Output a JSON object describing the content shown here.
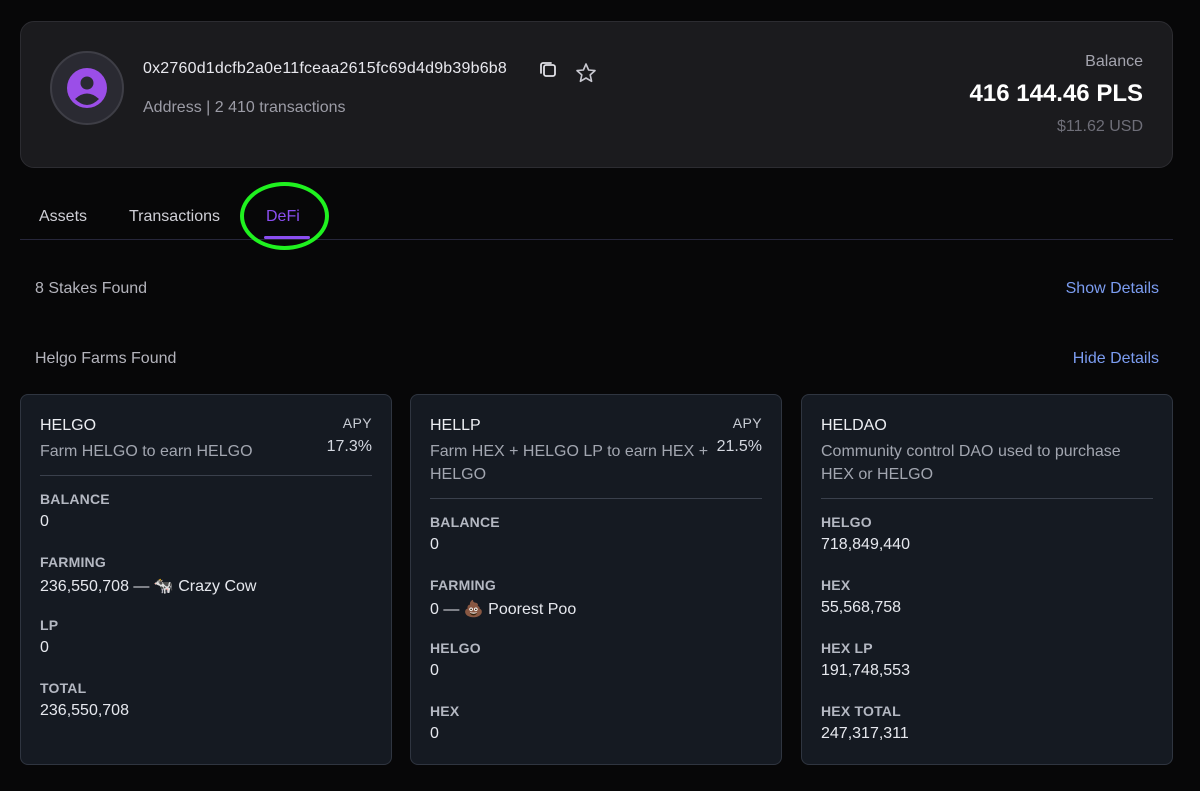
{
  "header": {
    "address": "0x2760d1dcfb2a0e11fceaa2615fc69d4d9b39b6b8",
    "subline": "Address | 2 410 transactions",
    "balance_label": "Balance",
    "balance_value": "416 144.46 PLS",
    "balance_usd": "$11.62 USD"
  },
  "tabs": [
    {
      "label": "Assets"
    },
    {
      "label": "Transactions"
    },
    {
      "label": "DeFi",
      "active": true
    }
  ],
  "stakes": {
    "label": "8 Stakes Found",
    "link": "Show Details"
  },
  "farms": {
    "label": "Helgo Farms Found",
    "link": "Hide Details"
  },
  "cards": [
    {
      "title": "HELGO",
      "desc": "Farm HELGO to earn HELGO",
      "apy_label": "APY",
      "apy_value": "17.3%",
      "stats": [
        {
          "label": "BALANCE",
          "value": "0"
        },
        {
          "label": "FARMING",
          "value": "236,550,708 — 🐄 Crazy Cow"
        },
        {
          "label": "LP",
          "value": "0"
        },
        {
          "label": "TOTAL",
          "value": "236,550,708"
        }
      ]
    },
    {
      "title": "HELLP",
      "desc": "Farm HEX + HELGO LP to earn HEX + HELGO",
      "apy_label": "APY",
      "apy_value": "21.5%",
      "stats": [
        {
          "label": "BALANCE",
          "value": "0"
        },
        {
          "label": "FARMING",
          "value": "0 — 💩 Poorest Poo"
        },
        {
          "label": "HELGO",
          "value": "0"
        },
        {
          "label": "HEX",
          "value": "0"
        }
      ]
    },
    {
      "title": "HELDAO",
      "desc": "Community control DAO used to purchase HEX or HELGO",
      "stats": [
        {
          "label": "HELGO",
          "value": "718,849,440"
        },
        {
          "label": "HEX",
          "value": "55,568,758"
        },
        {
          "label": "HEX LP",
          "value": "191,748,553"
        },
        {
          "label": "HEX TOTAL",
          "value": "247,317,311"
        }
      ]
    }
  ],
  "colors": {
    "accent": "#8a4ef0",
    "link": "#7b9cf0",
    "highlight": "#1ff21f",
    "avatar": "#9b4ee8"
  },
  "icons": {
    "avatar": "user-circle-icon",
    "copy": "copy-icon",
    "favorite": "star-icon"
  }
}
